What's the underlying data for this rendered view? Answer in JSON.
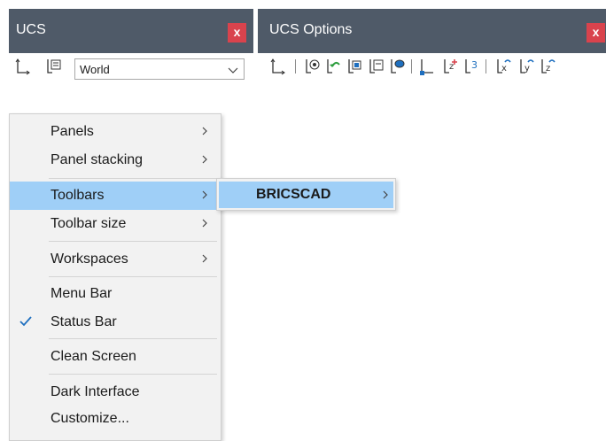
{
  "ucs_panel": {
    "title": "UCS",
    "close_label": "x",
    "dropdown_value": "World"
  },
  "ucs_options_panel": {
    "title": "UCS Options",
    "close_label": "x",
    "tool_icons": [
      "ucs-icon",
      "named-ucs-icon",
      "ucs-previous-icon",
      "ucs-face-icon",
      "ucs-view-icon",
      "ucs-object-icon",
      "ucs-origin-icon",
      "ucs-zaxis-icon",
      "ucs-3point-icon",
      "ucs-x-rotate-icon",
      "ucs-y-rotate-icon",
      "ucs-z-rotate-icon"
    ]
  },
  "context_menu": {
    "items": [
      {
        "label": "Panels",
        "submenu": true
      },
      {
        "label": "Panel stacking",
        "submenu": true
      },
      {
        "label": "Toolbars",
        "submenu": true
      },
      {
        "label": "Toolbar size",
        "submenu": true
      },
      {
        "label": "Workspaces",
        "submenu": true
      },
      {
        "label": "Menu Bar"
      },
      {
        "label": "Status Bar",
        "checked": true
      },
      {
        "label": "Clean Screen"
      },
      {
        "label": "Dark Interface"
      },
      {
        "label": "Customize..."
      }
    ],
    "highlighted": "Toolbars",
    "submenu": {
      "label": "BRICSCAD"
    }
  },
  "colors": {
    "header_bg": "#4f5a68",
    "close_bg": "#d9434d",
    "highlight": "#9fcff7",
    "icon_blue": "#1e6fbf",
    "icon_green": "#2e9e3f"
  }
}
